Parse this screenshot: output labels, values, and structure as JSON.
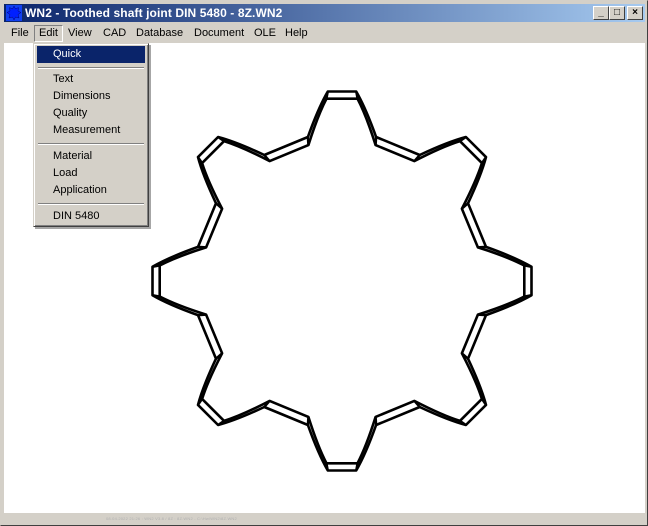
{
  "window": {
    "title": "WN2 - Toothed shaft joint DIN 5480  -  8Z.WN2",
    "app_icon": "gear-app-icon",
    "controls": {
      "minimize": "_",
      "maximize": "□",
      "close": "×"
    }
  },
  "menubar": {
    "items": [
      {
        "label": "File",
        "accel": "F"
      },
      {
        "label": "Edit",
        "accel": "E",
        "open": true
      },
      {
        "label": "View",
        "accel": "V"
      },
      {
        "label": "CAD",
        "accel": "C"
      },
      {
        "label": "Database",
        "accel": "D"
      },
      {
        "label": "Document",
        "accel": "c"
      },
      {
        "label": "OLE",
        "accel": "O"
      },
      {
        "label": "Help",
        "accel": "H"
      }
    ]
  },
  "edit_menu": {
    "items": [
      {
        "label": "Quick",
        "highlighted": true
      },
      {
        "label": "Text"
      },
      {
        "label": "Dimensions"
      },
      {
        "label": "Quality"
      },
      {
        "label": "Measurement"
      },
      {
        "label": "Material"
      },
      {
        "label": "Load"
      },
      {
        "label": "Application"
      },
      {
        "label": "DIN 5480"
      }
    ]
  },
  "drawing": {
    "description": "Toothed shaft joint cross-section",
    "teeth": 8,
    "stroke_color": "#000000",
    "background": "#ffffff"
  },
  "footer": {
    "text": "08.04.2022 21:26 : WN2 V3.8 / 8Z : 8Z.WN2 - C:\\Hw\\WN2\\8Z.WN2"
  },
  "colors": {
    "title_start": "#0a246a",
    "title_end": "#a6caf0",
    "menu_highlight": "#0a246a",
    "chrome": "#d4d0c8"
  }
}
